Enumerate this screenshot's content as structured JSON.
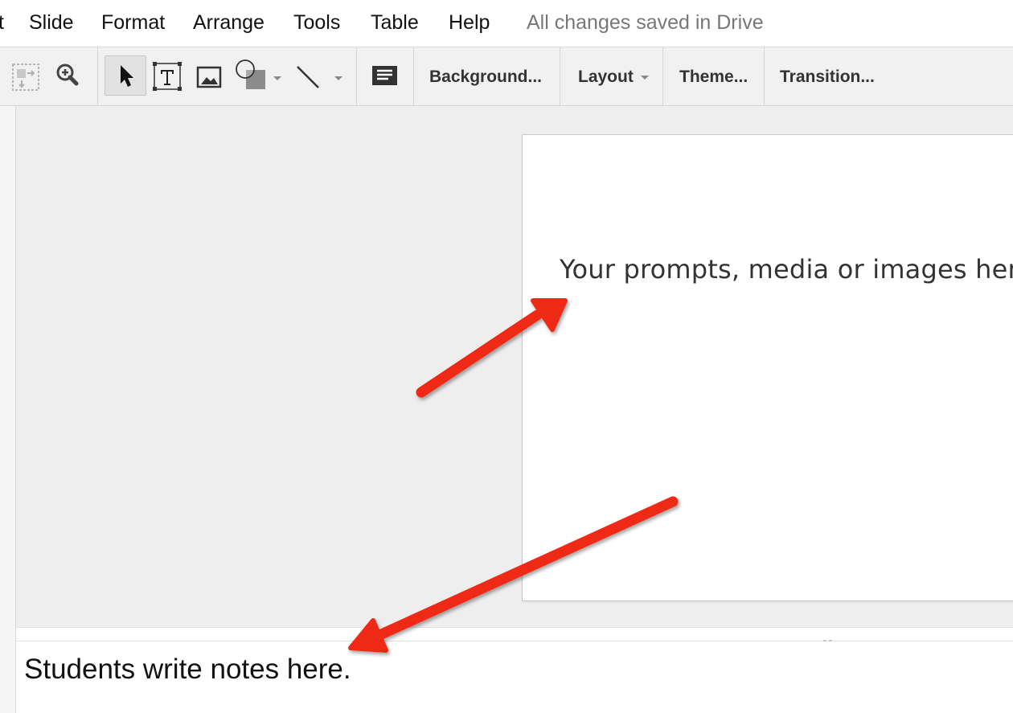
{
  "menu": {
    "items": [
      {
        "label": "t"
      },
      {
        "label": "Slide"
      },
      {
        "label": "Format"
      },
      {
        "label": "Arrange"
      },
      {
        "label": "Tools"
      },
      {
        "label": "Table"
      },
      {
        "label": "Help"
      }
    ],
    "status": "All changes saved in Drive"
  },
  "toolbar": {
    "icons": [
      "fit-to-screen-icon",
      "zoom-icon",
      "select-pointer-icon",
      "text-box-icon",
      "image-icon",
      "shape-icon",
      "line-icon",
      "comment-icon"
    ],
    "background_label": "Background...",
    "layout_label": "Layout",
    "theme_label": "Theme...",
    "transition_label": "Transition..."
  },
  "slide": {
    "body_text": "Your prompts, media or images here"
  },
  "notes": {
    "text": "Students write notes here."
  },
  "colors": {
    "annotation_arrow": "#ee2a12",
    "canvas_bg": "#eeeeee",
    "toolbar_bg": "#f1f1f1"
  }
}
